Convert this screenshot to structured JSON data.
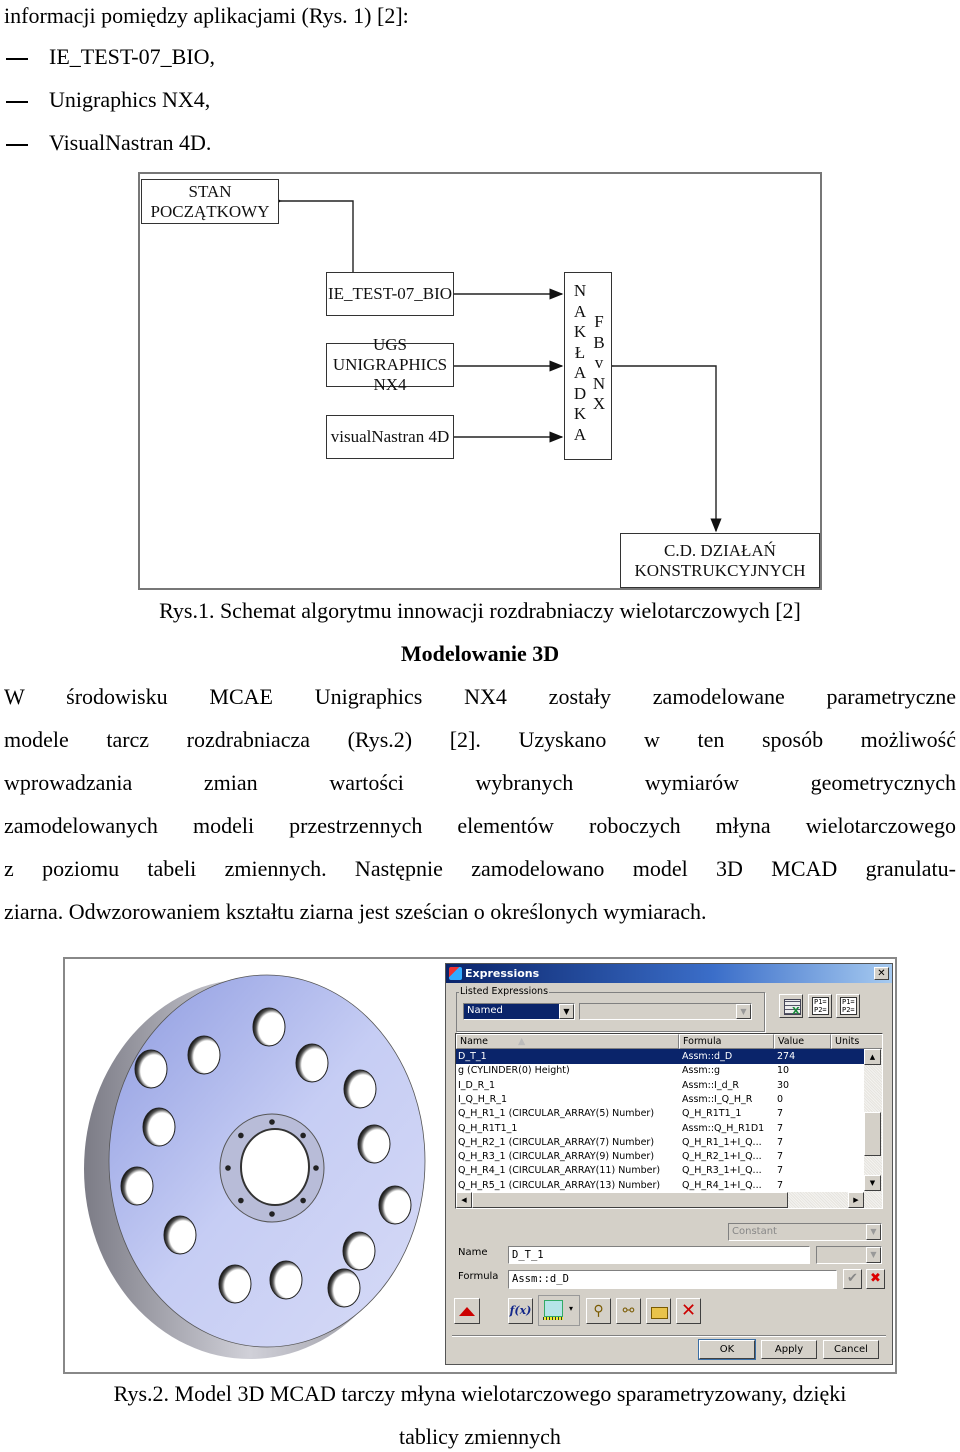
{
  "intro_line": "informacji pomiędzy aplikacjami (Rys. 1) [2]:",
  "bullets": [
    "IE_TEST-07_BIO,",
    "Unigraphics NX4,",
    "VisualNastran 4D."
  ],
  "diagram": {
    "start_box": "STAN POCZĄTKOWY",
    "app_boxes": [
      {
        "lines": [
          "IE_TEST-07_BIO"
        ]
      },
      {
        "lines": [
          "UGS",
          "UNIGRAPHICS NX4"
        ]
      },
      {
        "lines": [
          "visualNastran 4D"
        ]
      }
    ],
    "overlay_letters": [
      "N",
      "A",
      "K",
      "Ł",
      "A",
      "D",
      "K",
      "A"
    ],
    "fb_letters": [
      "F",
      "B",
      "v",
      "N",
      "X"
    ],
    "end_box": [
      "C.D. DZIAŁAŃ",
      "KONSTRUKCYJNYCH"
    ]
  },
  "caption1": "Rys.1. Schemat algorytmu innowacji rozdrabniaczy wielotarczowych [2]",
  "section_heading": "Modelowanie 3D",
  "paragraph_lines": [
    "W środowisku MCAE Unigraphics NX4 zostały zamodelowane parametryczne",
    "modele tarcz rozdrabniacza (Rys.2) [2]. Uzyskano w ten sposób możliwość",
    "wprowadzania zmian wartości wybranych wymiarów geometrycznych",
    "zamodelowanych modeli przestrzennych elementów roboczych młyna wielotarczowego",
    "z poziomu tabeli zmiennych. Następnie zamodelowano model 3D MCAD granulatu-"
  ],
  "paragraph_last_line": "ziarna. Odwzorowaniem kształtu ziarna jest sześcian o określonych wymiarach.",
  "expressions_dialog": {
    "title": "Expressions",
    "group_label": "Listed Expressions",
    "filter_value": "Named",
    "columns": [
      "Name",
      "Formula",
      "Value",
      "Units"
    ],
    "rows": [
      {
        "name": "D_T_1",
        "formula": "Assm::d_D",
        "value": "274",
        "units": "",
        "selected": true
      },
      {
        "name": "g  (CYLINDER(0) Height)",
        "formula": "Assm::g",
        "value": "10",
        "units": ""
      },
      {
        "name": "I_D_R_1",
        "formula": "Assm::I_d_R",
        "value": "30",
        "units": ""
      },
      {
        "name": "I_Q_H_R_1",
        "formula": "Assm::I_Q_H_R",
        "value": "0",
        "units": ""
      },
      {
        "name": "Q_H_R1_1  (CIRCULAR_ARRAY(5) Number)",
        "formula": "Q_H_R1T1_1",
        "value": "7",
        "units": ""
      },
      {
        "name": "Q_H_R1T1_1",
        "formula": "Assm::Q_H_R1D1",
        "value": "7",
        "units": ""
      },
      {
        "name": "Q_H_R2_1  (CIRCULAR_ARRAY(7) Number)",
        "formula": "Q_H_R1_1+I_Q...",
        "value": "7",
        "units": ""
      },
      {
        "name": "Q_H_R3_1  (CIRCULAR_ARRAY(9) Number)",
        "formula": "Q_H_R2_1+I_Q...",
        "value": "7",
        "units": ""
      },
      {
        "name": "Q_H_R4_1  (CIRCULAR_ARRAY(11) Number)",
        "formula": "Q_H_R3_1+I_Q...",
        "value": "7",
        "units": ""
      },
      {
        "name": "Q_H_R5_1  (CIRCULAR_ARRAY(13) Number)",
        "formula": "Q_H_R4_1+I_Q...",
        "value": "7",
        "units": ""
      }
    ],
    "type_value": "Constant",
    "name_label": "Name",
    "name_value": "D_T_1",
    "formula_label": "Formula",
    "formula_value": "Assm::d_D",
    "icons": {
      "spreadsheet": "spreadsheet-icon",
      "import": "import-expressions-icon",
      "export": "export-expressions-icon"
    },
    "buttons": {
      "ok": "OK",
      "apply": "Apply",
      "cancel": "Cancel",
      "fx": "f(x)"
    }
  },
  "caption2_line1": "Rys.2. Model 3D MCAD tarczy młyna wielotarczowego sparametryzowany, dzięki",
  "caption2_line2": "tablicy zmiennych"
}
